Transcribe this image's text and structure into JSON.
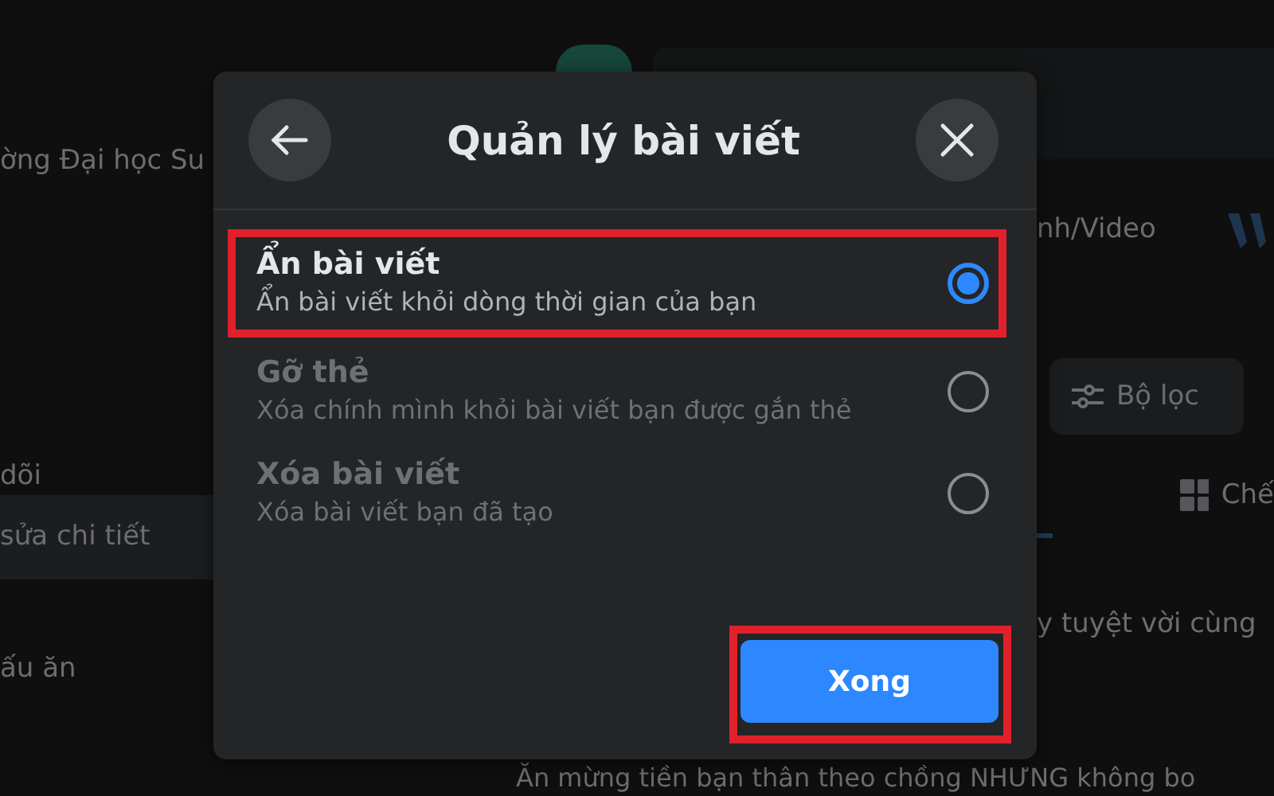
{
  "background": {
    "sidebar_items": [
      {
        "label": "ờng Đại học Su",
        "selected": false
      },
      {
        "label": "dõi",
        "selected": false
      },
      {
        "label": "sửa chi tiết",
        "selected": true
      },
      {
        "label": "ấu ăn",
        "selected": false
      }
    ],
    "tab_label": "nh/Video",
    "filter_button": "Bộ lọc",
    "view_tab": "Chế",
    "post_snippet": "y tuyệt vời cùng",
    "post_title": "Ăn mừng tiền bạn thân theo chồng NHƯNG không bo"
  },
  "dialog": {
    "title": "Quản lý bài viết",
    "options": [
      {
        "title": "Ẩn bài viết",
        "description": "Ẩn bài viết khỏi dòng thời gian của bạn",
        "selected": true,
        "disabled": false,
        "highlighted": true
      },
      {
        "title": "Gỡ thẻ",
        "description": "Xóa chính mình khỏi bài viết bạn được gắn thẻ",
        "selected": false,
        "disabled": true,
        "highlighted": false
      },
      {
        "title": "Xóa bài viết",
        "description": "Xóa bài viết bạn đã tạo",
        "selected": false,
        "disabled": true,
        "highlighted": false
      }
    ],
    "done_button": {
      "label": "Xong",
      "highlighted": true
    }
  }
}
